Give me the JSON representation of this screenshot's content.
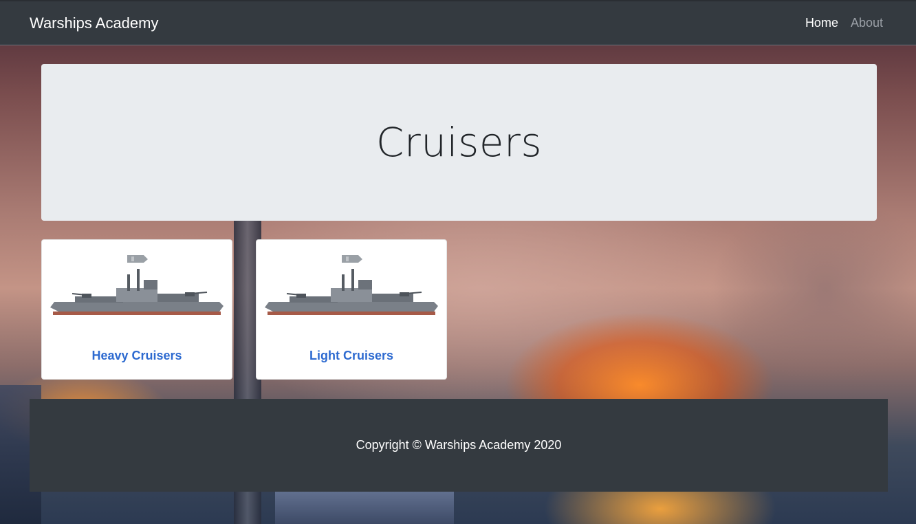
{
  "navbar": {
    "brand": "Warships Academy",
    "links": [
      {
        "label": "Home",
        "active": true
      },
      {
        "label": "About",
        "active": false
      }
    ]
  },
  "jumbotron": {
    "title": "Cruisers"
  },
  "cards": [
    {
      "label": "Heavy Cruisers",
      "image": "warship-image"
    },
    {
      "label": "Light Cruisers",
      "image": "warship-image"
    }
  ],
  "footer": {
    "copyright": "Copyright © Warships Academy 2020"
  },
  "colors": {
    "navbar_bg": "#343a40",
    "jumbotron_bg": "#e9ecef",
    "link_blue": "#2d6ad0"
  }
}
